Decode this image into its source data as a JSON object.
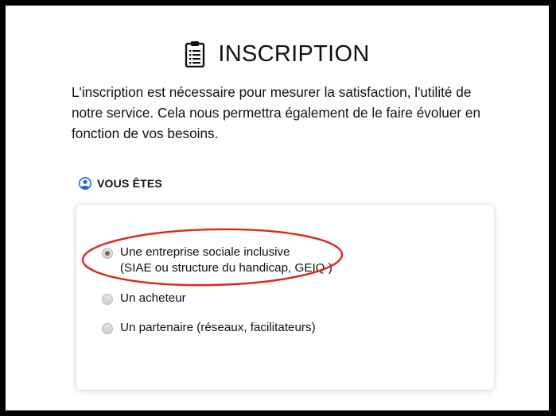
{
  "header": {
    "icon": "clipboard-icon",
    "title": "INSCRIPTION"
  },
  "intro": {
    "text": "L'inscription est nécessaire pour mesurer la satisfaction, l'utilité de notre service. Cela nous permettra également de le faire évoluer en fonction de vos besoins."
  },
  "section": {
    "icon": "user-circle-icon",
    "label": "VOUS ÊTES",
    "icon_color": "#1a6fd6"
  },
  "options": [
    {
      "line1": "Une entreprise sociale inclusive",
      "line2": "(SIAE ou structure du handicap, GEIQ )",
      "checked": true
    },
    {
      "line1": "Un acheteur",
      "checked": false
    },
    {
      "line1": "Un partenaire (réseaux, facilitateurs)",
      "checked": false
    }
  ],
  "annotation": {
    "color": "#e0261b"
  }
}
